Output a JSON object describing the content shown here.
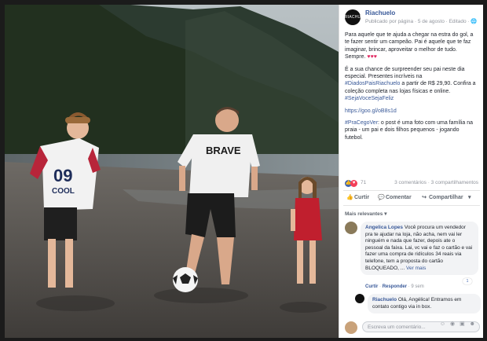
{
  "post": {
    "page_name": "Riachuelo",
    "avatar_text": "RIACHUELO",
    "meta": "Publicado por página · 5 de agosto · Editado · 🌐",
    "p1": "Para aquele que te ajuda a chegar na estra do gol, a te fazer sentir um campeão. Pai é aquele que te faz imaginar, brincar, aproveitar o melhor de tudo. Sempre.",
    "p1_hearts": "♥♥♥",
    "p2_start": "É a sua chance de surpreender seu pai neste dia especial. Presentes incríveis na ",
    "p2_tag1": "#DiadosPaisRiachuelo",
    "p2_mid": " a partir de R$ 29,90. Confira a coleção completa nas lojas físicas e online. ",
    "p2_tag2": "#SejaVoceSejaFeliz",
    "p3_link": "https://goo.gl/oB8s1d",
    "p4_tag": "#PraCegoVer",
    "p4_text": ": o post é uma foto com uma família na praia - um pai e dois filhos pequenos - jogando futebol."
  },
  "photo": {
    "shirt_text": "BRAVE",
    "kid_shirt_number": "09",
    "kid_shirt_word": "COOL"
  },
  "reactions": {
    "like_icon": "👍",
    "love_icon": "♥",
    "count": "71",
    "summary": "3 comentários · 3 compartilhamentos"
  },
  "actions": {
    "like": "Curtir",
    "like_icon": "thumbs-up",
    "comment": "Comentar",
    "comment_icon": "speech-bubble",
    "share": "Compartilhar",
    "share_icon": "share-arrow"
  },
  "comments": {
    "sort_label": "Mais relevantes ▾",
    "c1_author": "Angelica Lopes",
    "c1_text": "Você procura um vendedor pra te ajudar na loja, não acha, nem vai ler ninguém e nada que fazer, depois ate o pessoal da faixa. Lai, vc vai e faz o cartão e vai fazer uma compra de ridículos 34 reais via telefone, tem a proposta do cartão BLOQUEADO, ...",
    "c1_more": "Ver mais",
    "c1_actions_like": "Curtir",
    "c1_actions_reply": "Responder",
    "c1_time": "· 9 sem",
    "c1_likes": "1",
    "c2_author": "Riachuelo",
    "c2_text": "Olá, Angélica! Entramos em contato contigo via in box.",
    "composer_placeholder": "Escreva um comentário...",
    "composer_tools": "☺ ◉ ▣ ☻"
  }
}
